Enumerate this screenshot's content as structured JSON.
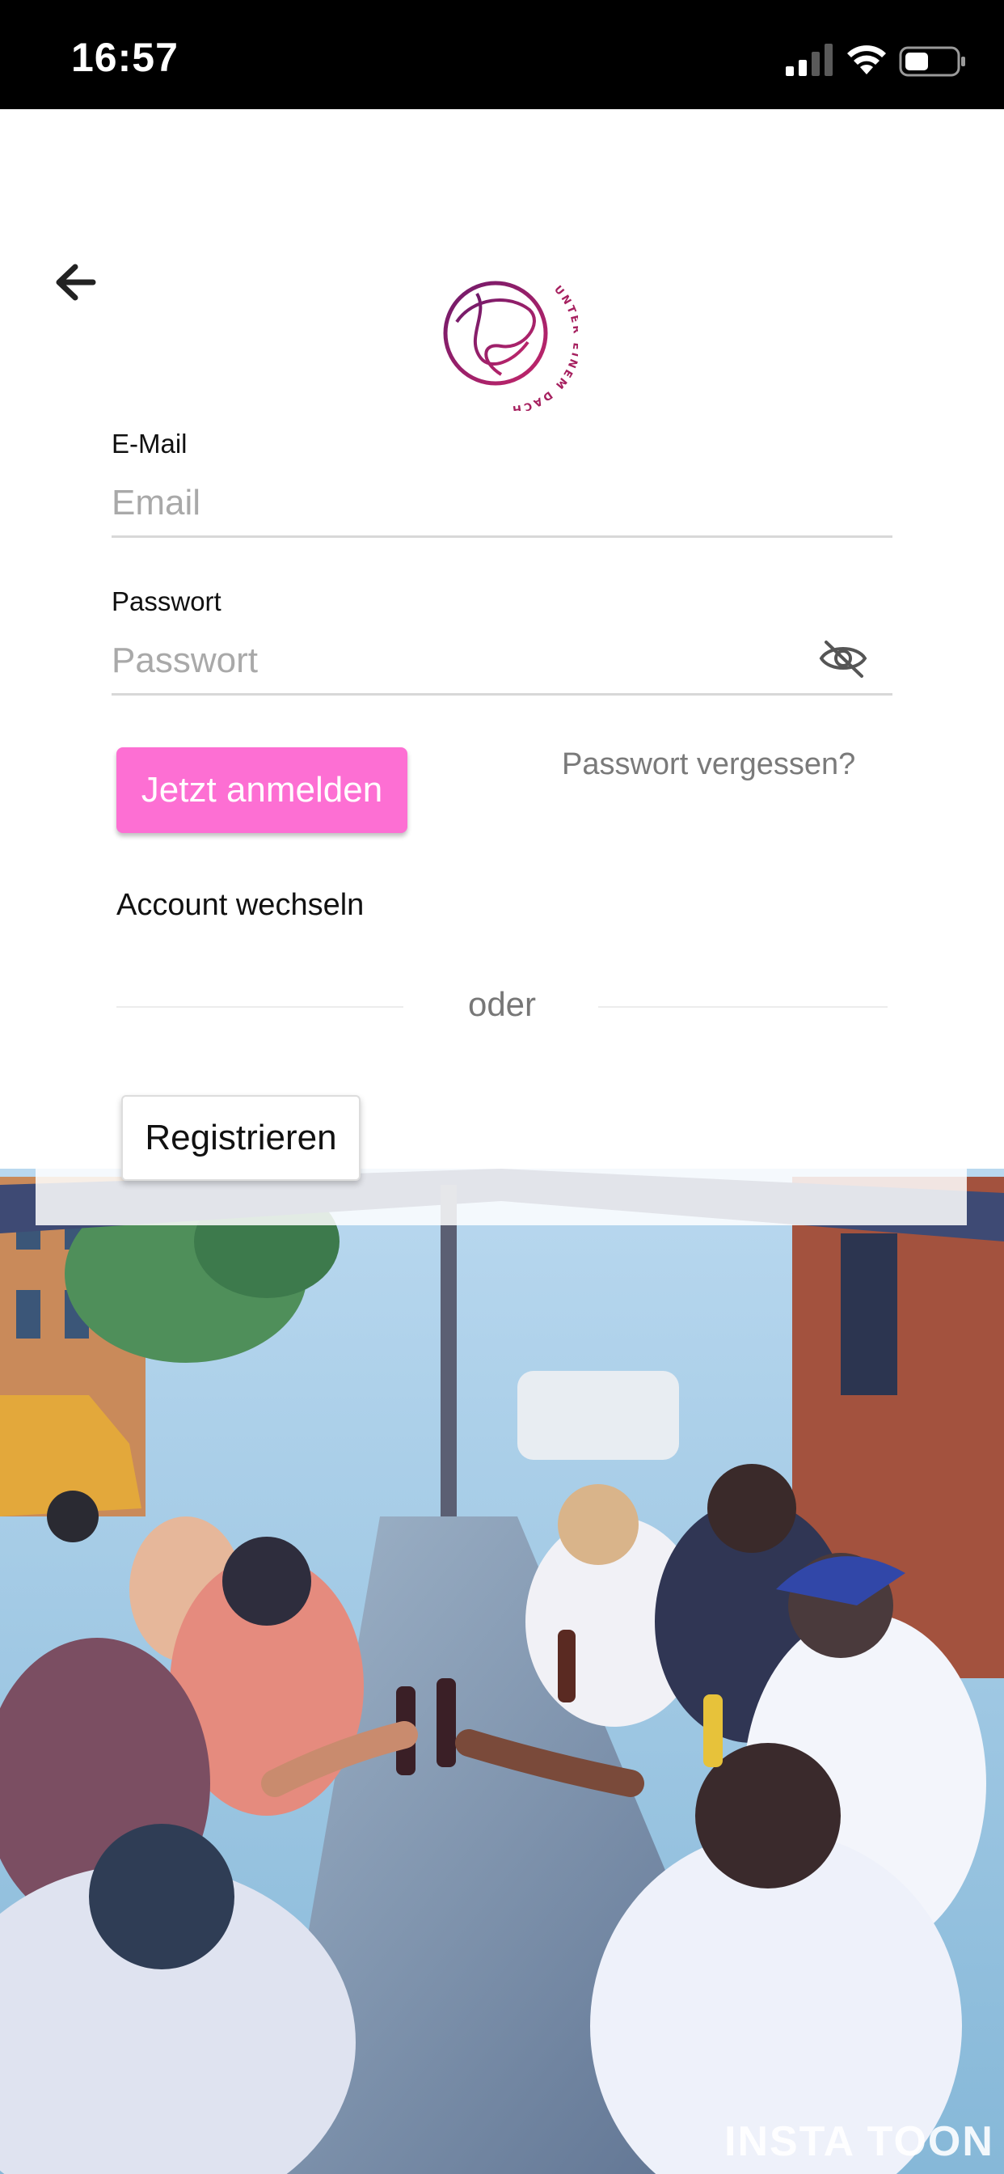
{
  "status_bar": {
    "time": "16:57"
  },
  "logo": {
    "text": "UNTER EINEM DACH",
    "color": "#9a1f6b"
  },
  "form": {
    "email": {
      "label": "E-Mail",
      "placeholder": "Email",
      "value": ""
    },
    "password": {
      "label": "Passwort",
      "placeholder": "Passwort",
      "value": "",
      "toggle_icon": "eye-slash-icon"
    }
  },
  "actions": {
    "login_label": "Jetzt anmelden",
    "forgot_label": "Passwort vergessen?",
    "switch_account_label": "Account wechseln",
    "divider_label": "oder",
    "register_label": "Registrieren"
  },
  "background": {
    "watermark": "INSTA TOON"
  },
  "colors": {
    "accent": "#fd6fd3",
    "logo": "#9a1f6b"
  }
}
